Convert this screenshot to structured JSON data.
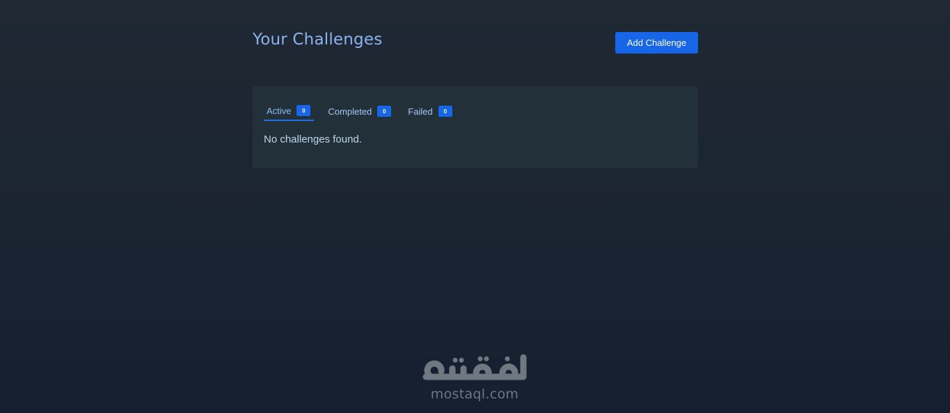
{
  "header": {
    "title": "Your Challenges",
    "add_button_label": "Add Challenge"
  },
  "tabs": [
    {
      "label": "Active",
      "count": "0",
      "active": true
    },
    {
      "label": "Completed",
      "count": "0",
      "active": false
    },
    {
      "label": "Failed",
      "count": "0",
      "active": false
    }
  ],
  "content": {
    "empty_message": "No challenges found."
  },
  "watermark": {
    "logo_text": "مستقل",
    "text": "mostaql.com"
  },
  "colors": {
    "accent": "#1766e8",
    "title": "#8ab4f0",
    "card_background": "#223039"
  },
  "icons": {
    "watermark_logo": "mostaql-logo-icon"
  }
}
